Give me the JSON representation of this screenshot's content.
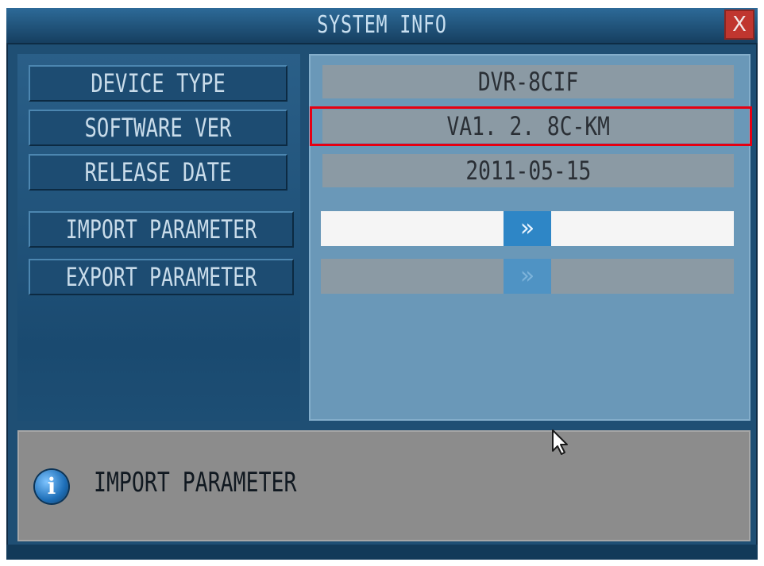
{
  "window": {
    "title": "SYSTEM INFO",
    "close_label": "X"
  },
  "info_rows": [
    {
      "label": "DEVICE TYPE",
      "value": "DVR-8CIF"
    },
    {
      "label": "SOFTWARE VER",
      "value": "VA1. 2. 8C-KM"
    },
    {
      "label": "RELEASE DATE",
      "value": "2011-05-15"
    }
  ],
  "actions": [
    {
      "label": "IMPORT PARAMETER",
      "arrow": "»"
    },
    {
      "label": "EXPORT PARAMETER",
      "arrow": "»"
    }
  ],
  "status": {
    "icon": "info-icon",
    "icon_glyph": "i",
    "text": "IMPORT PARAMETER"
  },
  "colors": {
    "window_bg": "#1f4f74",
    "value_bg": "#8b9aa4",
    "highlight": "#e60012",
    "arrow_bg": "#2e86c6"
  }
}
